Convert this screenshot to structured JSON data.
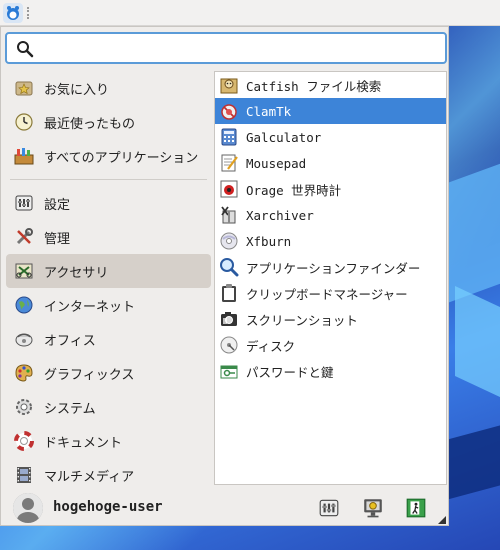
{
  "search": {
    "placeholder": "",
    "value": ""
  },
  "categories": [
    {
      "label": "お気に入り",
      "icon": "favorites-icon"
    },
    {
      "label": "最近使ったもの",
      "icon": "recent-clock-icon"
    },
    {
      "label": "すべてのアプリケーション",
      "icon": "all-apps-icon"
    },
    {
      "label": "設定",
      "icon": "settings-icon"
    },
    {
      "label": "管理",
      "icon": "admin-tools-icon"
    },
    {
      "label": "アクセサリ",
      "icon": "accessories-icon",
      "selected": true
    },
    {
      "label": "インターネット",
      "icon": "globe-icon"
    },
    {
      "label": "オフィス",
      "icon": "office-icon"
    },
    {
      "label": "グラフィックス",
      "icon": "graphics-palette-icon"
    },
    {
      "label": "システム",
      "icon": "system-gear-icon"
    },
    {
      "label": "ドキュメント",
      "icon": "help-lifebuoy-icon"
    },
    {
      "label": "マルチメディア",
      "icon": "multimedia-film-icon"
    }
  ],
  "apps": [
    {
      "label": "Catfish ファイル検索",
      "icon": "catfish-icon"
    },
    {
      "label": "ClamTk",
      "icon": "clamtk-icon",
      "selected": true
    },
    {
      "label": "Galculator",
      "icon": "calculator-icon"
    },
    {
      "label": "Mousepad",
      "icon": "text-editor-icon"
    },
    {
      "label": "Orage 世界時計",
      "icon": "world-clock-icon"
    },
    {
      "label": "Xarchiver",
      "icon": "archiver-icon"
    },
    {
      "label": "Xfburn",
      "icon": "disc-burner-icon"
    },
    {
      "label": "アプリケーションファインダー",
      "icon": "app-finder-icon"
    },
    {
      "label": "クリップボードマネージャー",
      "icon": "clipboard-icon"
    },
    {
      "label": "スクリーンショット",
      "icon": "screenshot-icon"
    },
    {
      "label": "ディスク",
      "icon": "disks-icon"
    },
    {
      "label": "パスワードと鍵",
      "icon": "passwords-keys-icon"
    }
  ],
  "footer": {
    "username": "hogehoge-user"
  },
  "colors": {
    "selection": "#3d84d8",
    "search_border": "#5b9bd8",
    "category_active": "#d6d0ca"
  }
}
